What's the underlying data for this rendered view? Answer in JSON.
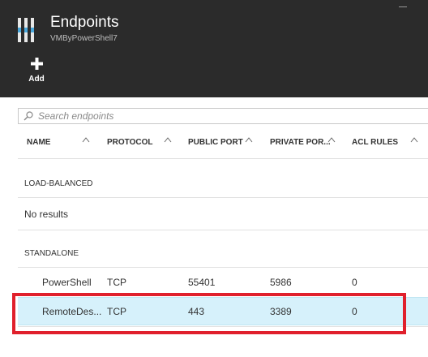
{
  "blade": {
    "title": "Endpoints",
    "subtitle": "VMByPowerShell7"
  },
  "toolbar": {
    "add_label": "Add"
  },
  "search": {
    "placeholder": "Search endpoints",
    "value": ""
  },
  "table": {
    "columns": [
      "NAME",
      "PROTOCOL",
      "PUBLIC PORT",
      "PRIVATE POR...",
      "ACL RULES"
    ],
    "sections": [
      {
        "label": "LOAD-BALANCED",
        "empty_text": "No results",
        "rows": []
      },
      {
        "label": "STANDALONE",
        "rows": [
          {
            "name": "PowerShell",
            "protocol": "TCP",
            "public_port": "55401",
            "private_port": "5986",
            "acl_rules": "0",
            "selected": false
          },
          {
            "name": "RemoteDes...",
            "protocol": "TCP",
            "public_port": "443",
            "private_port": "3389",
            "acl_rules": "0",
            "selected": true
          }
        ]
      }
    ]
  },
  "colors": {
    "header_bg": "#2b2b2b",
    "selected_row": "#d6f1fb",
    "highlight_border": "#e0202c"
  },
  "icons": {
    "blade": "endpoints-blade-icon",
    "add": "plus-icon",
    "search": "search-icon",
    "sort": "sort-arrow-icon"
  }
}
